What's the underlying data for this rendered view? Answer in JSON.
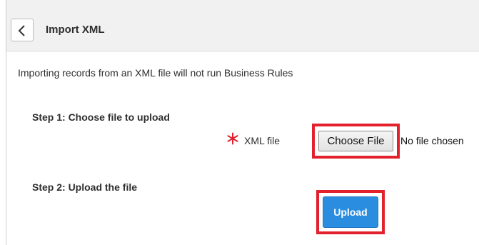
{
  "header": {
    "back_icon": "chevron-left-icon",
    "title": "Import XML"
  },
  "notice": "Importing records from an XML file will not run Business Rules",
  "step1": {
    "label": "Step 1: Choose file to upload",
    "required_icon": "asterisk-icon",
    "required_color": "#e3212d",
    "field_label": "XML file",
    "choose_button": "Choose File",
    "file_status": "No file chosen"
  },
  "step2": {
    "label": "Step 2: Upload the file",
    "upload_button": "Upload",
    "upload_color": "#2b8de0"
  },
  "highlight_color": "#e3212d"
}
